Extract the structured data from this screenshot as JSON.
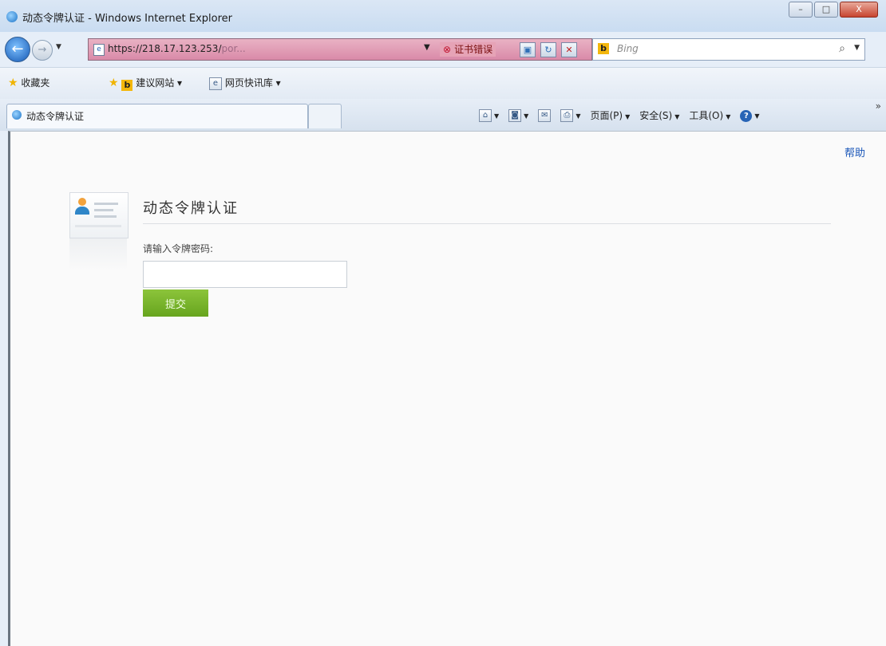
{
  "window": {
    "title": "动态令牌认证 - Windows Internet Explorer",
    "controls": {
      "minimize": "–",
      "maximize": "□",
      "close": "X"
    }
  },
  "address": {
    "url_host": "https://218.17.123.253/",
    "url_path": "por...",
    "cert_error": "证书错误",
    "search_placeholder": "Bing"
  },
  "favorites": {
    "favorites_label": "收藏夹",
    "suggested_sites": "建议网站 ▾",
    "web_slice": "网页快讯库 ▾"
  },
  "tabs": [
    {
      "label": "动态令牌认证"
    }
  ],
  "command_bar": {
    "page": "页面(P)",
    "safety": "安全(S)",
    "tools": "工具(O)"
  },
  "content": {
    "help_link": "帮助",
    "title": "动态令牌认证",
    "password_label": "请输入令牌密码:",
    "password_value": "",
    "submit_label": "提交"
  }
}
